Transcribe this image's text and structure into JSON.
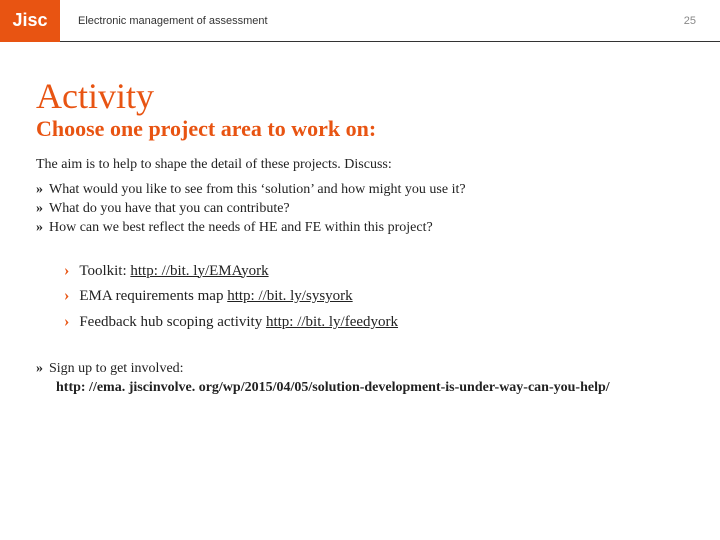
{
  "header": {
    "logo": "Jisc",
    "running_title": "Electronic management of assessment",
    "page_number": "25"
  },
  "title": "Activity",
  "subtitle": "Choose one project area to work on:",
  "intro": "The aim is to help to shape the detail of these projects. Discuss:",
  "questions": [
    "What would you like to see from this ‘solution’ and how might you use it?",
    "What do you have that you can contribute?",
    "How can we best reflect the needs of HE and FE within this project?"
  ],
  "links": [
    {
      "label": "Toolkit: ",
      "url": "http: //bit. ly/EMAyork"
    },
    {
      "label": "EMA requirements map ",
      "url": "http: //bit. ly/sysyork"
    },
    {
      "label": "Feedback hub scoping activity ",
      "url": "http: //bit. ly/feedyork"
    }
  ],
  "signup": {
    "label": "Sign up to get involved:",
    "url": "http: //ema. jiscinvolve. org/wp/2015/04/05/solution-development-is-under-way-can-you-help/"
  }
}
